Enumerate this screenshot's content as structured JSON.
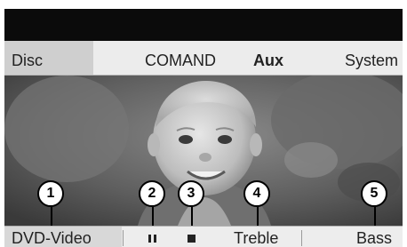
{
  "menu": {
    "items": [
      {
        "label": "Disc",
        "selected": false
      },
      {
        "label": "COMAND",
        "selected": false
      },
      {
        "label": "Aux",
        "selected": true
      },
      {
        "label": "System",
        "selected": false
      }
    ]
  },
  "bottom": {
    "source_label": "DVD-Video",
    "pause_icon": "pause-icon",
    "stop_icon": "stop-icon",
    "treble_label": "Treble",
    "bass_label": "Bass"
  },
  "callouts": [
    "1",
    "2",
    "3",
    "4",
    "5"
  ],
  "colors": {
    "menu_bg": "#ececec",
    "menu_selected_bg": "#cfcfcf",
    "bottom_bg": "#ededed",
    "top_bar": "#0b0b0b"
  }
}
